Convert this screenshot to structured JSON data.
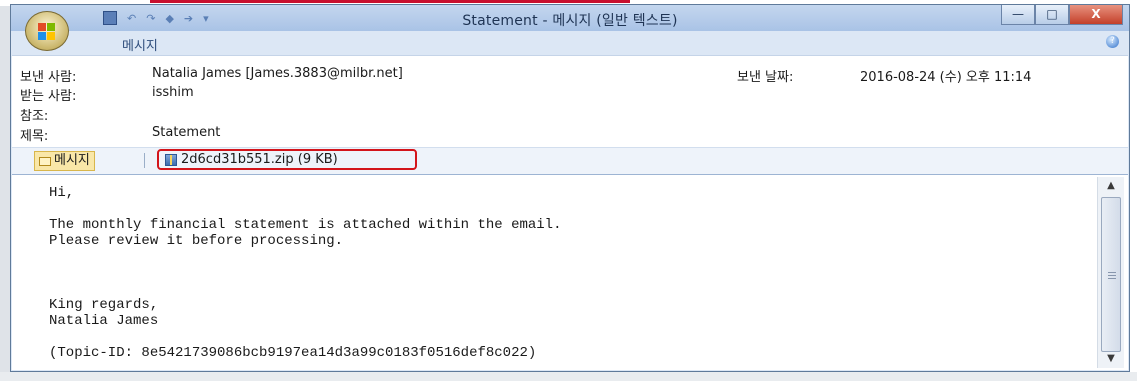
{
  "window": {
    "title": "Statement - 메시지 (일반 텍스트)",
    "minimize_label": "—",
    "maximize_label": "□",
    "close_label": "X"
  },
  "ribbon": {
    "tab_label": "메시지"
  },
  "header": {
    "from_label": "보낸 사람:",
    "from_value": "Natalia James [James.3883@milbr.net]",
    "sent_label": "보낸 날짜:",
    "sent_value": "2016-08-24 (수) 오후 11:14",
    "to_label": "받는 사람:",
    "to_value": "isshim",
    "cc_label": "참조:",
    "cc_value": "",
    "subject_label": "제목:",
    "subject_value": "Statement"
  },
  "attachments": {
    "message_tab": "메시지",
    "file": "2d6cd31b551.zip (9 KB)"
  },
  "body": {
    "text": "Hi,\n\nThe monthly financial statement is attached within the email.\nPlease review it before processing.\n\n\n\nKing regards,\nNatalia James\n\n(Topic-ID: 8e5421739086bcb9197ea14d3a99c0183f0516def8c022)"
  },
  "colors": {
    "highlight_box": "#d3141a",
    "title_bar": "#a9c3e6"
  }
}
